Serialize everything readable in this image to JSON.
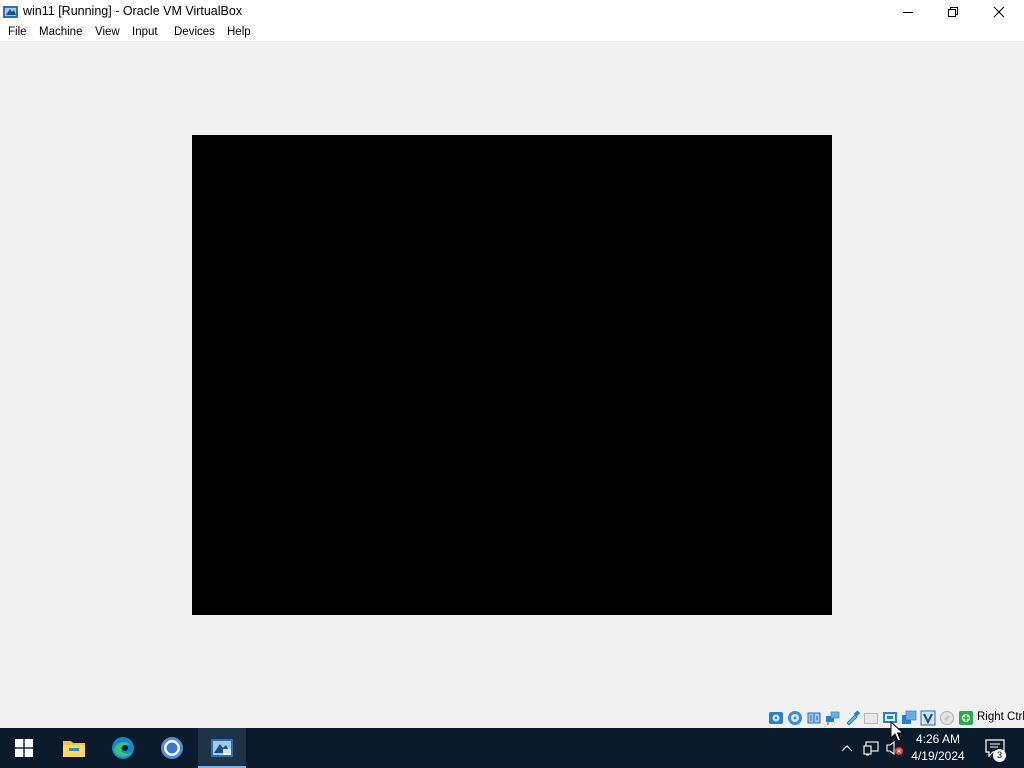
{
  "window": {
    "title": "win11 [Running] - Oracle VM VirtualBox"
  },
  "menu": {
    "items": [
      {
        "label": "File"
      },
      {
        "label": "Machine"
      },
      {
        "label": "View"
      },
      {
        "label": "Input"
      },
      {
        "label": "Devices"
      },
      {
        "label": "Help"
      }
    ]
  },
  "statusbar": {
    "icons": [
      "hard-disk-icon",
      "optical-drive-icon",
      "audio-icon",
      "network-icon",
      "usb-icon",
      "shared-folders-icon",
      "display-icon",
      "video-capture-icon",
      "virtualization-icon",
      "mouse-integration-icon",
      "keyboard-capture-icon"
    ],
    "host_key": "Right Ctrl"
  },
  "taskbar": {
    "apps": [
      "windows-start-icon",
      "file-explorer-icon",
      "edge-icon",
      "chrome-icon",
      "virtualbox-icon"
    ],
    "clock_time": "4:26 AM",
    "clock_date": "4/19/2024",
    "notification_count": "3"
  },
  "colors": {
    "taskbar_bg": "#0c1b2c",
    "window_bg": "#f0f0f0",
    "vm_screen": "#000000",
    "accent": "#76b9ed"
  }
}
